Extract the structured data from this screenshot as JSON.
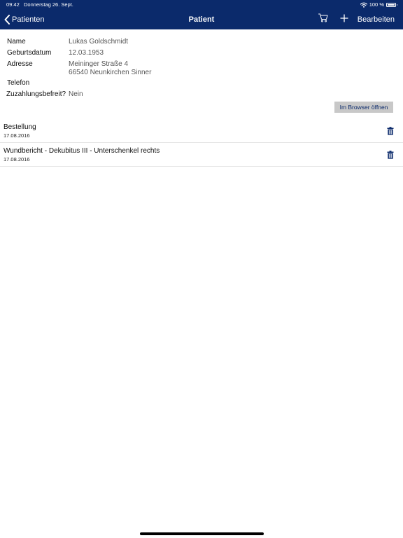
{
  "status_bar": {
    "time": "09:42",
    "date": "Donnerstag 26. Sept.",
    "battery": "100 %",
    "wifi_icon": "wifi-icon",
    "battery_icon": "battery-icon"
  },
  "nav": {
    "back_label": "Patienten",
    "title": "Patient",
    "edit_label": "Bearbeiten",
    "cart_icon": "cart-icon",
    "add_icon": "plus-icon",
    "back_icon": "chevron-left-icon"
  },
  "patient": {
    "name_label": "Name",
    "name_value": "Lukas Goldschmidt",
    "birth_label": "Geburtsdatum",
    "birth_value": "12.03.1953",
    "address_label": "Adresse",
    "address_line1": "Meininger Straße 4",
    "address_line2": "66540 Neunkirchen Sinner",
    "phone_label": "Telefon",
    "phone_value": "",
    "copay_label": "Zuzahlungsbefreit?",
    "copay_value": "Nein"
  },
  "actions": {
    "open_browser_label": "Im Browser öffnen"
  },
  "documents": [
    {
      "title": "Bestellung",
      "date": "17.08.2016",
      "icon": "trash-icon"
    },
    {
      "title": "Wundbericht - Dekubitus III - Unterschenkel rechts",
      "date": "17.08.2016",
      "icon": "trash-icon"
    }
  ],
  "colors": {
    "nav_background": "#0b2a6b",
    "nav_text": "#ffffff",
    "accent": "#0b2a6b",
    "button_background": "#c8c8c8",
    "value_text": "#555555"
  }
}
